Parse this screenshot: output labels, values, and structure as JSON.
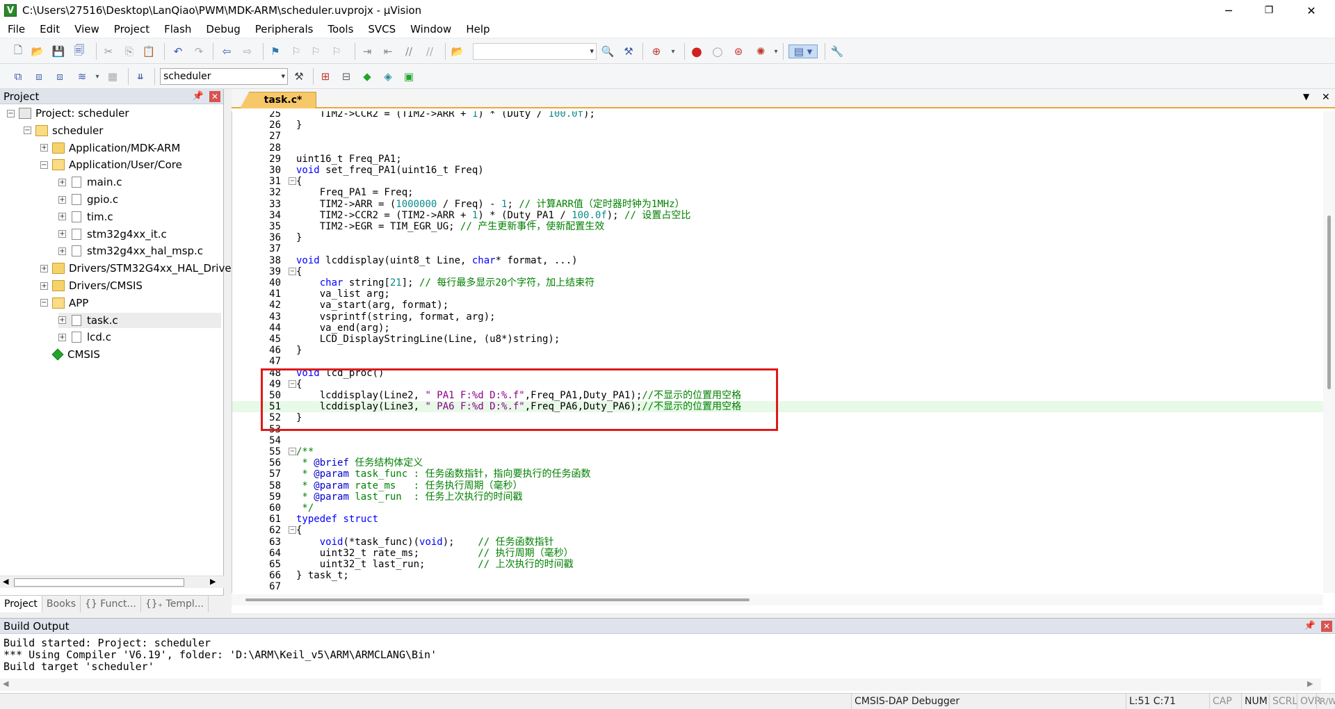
{
  "window": {
    "title": "C:\\Users\\27516\\Desktop\\LanQiao\\PWM\\MDK-ARM\\scheduler.uvprojx - µVision",
    "minimize": "─",
    "restore": "❐",
    "close": "✕"
  },
  "menu": [
    "File",
    "Edit",
    "View",
    "Project",
    "Flash",
    "Debug",
    "Peripherals",
    "Tools",
    "SVCS",
    "Window",
    "Help"
  ],
  "toolbar2": {
    "target_select": "scheduler"
  },
  "project_panel": {
    "title": "Project",
    "tree": [
      {
        "label": "Project: scheduler",
        "icon": "project-icon",
        "level": 0,
        "expand": "⊟"
      },
      {
        "label": "scheduler",
        "icon": "target-icon",
        "level": 1,
        "expand": "⊟"
      },
      {
        "label": "Application/MDK-ARM",
        "icon": "folder-icon",
        "level": 2,
        "expand": "⊞"
      },
      {
        "label": "Application/User/Core",
        "icon": "folder-open-icon",
        "level": 2,
        "expand": "⊟"
      },
      {
        "label": "main.c",
        "icon": "file-icon",
        "level": 3,
        "expand": "⊞"
      },
      {
        "label": "gpio.c",
        "icon": "file-icon",
        "level": 3,
        "expand": "⊞"
      },
      {
        "label": "tim.c",
        "icon": "file-icon",
        "level": 3,
        "expand": "⊞"
      },
      {
        "label": "stm32g4xx_it.c",
        "icon": "file-icon",
        "level": 3,
        "expand": "⊞"
      },
      {
        "label": "stm32g4xx_hal_msp.c",
        "icon": "file-icon",
        "level": 3,
        "expand": "⊞"
      },
      {
        "label": "Drivers/STM32G4xx_HAL_Driver",
        "icon": "folder-icon",
        "level": 2,
        "expand": "⊞"
      },
      {
        "label": "Drivers/CMSIS",
        "icon": "folder-icon",
        "level": 2,
        "expand": "⊞"
      },
      {
        "label": "APP",
        "icon": "folder-open-icon",
        "level": 2,
        "expand": "⊟"
      },
      {
        "label": "task.c",
        "icon": "file-icon",
        "level": 3,
        "expand": "⊞",
        "selected": true
      },
      {
        "label": "lcd.c",
        "icon": "file-icon",
        "level": 3,
        "expand": "⊞"
      },
      {
        "label": "CMSIS",
        "icon": "cmsis-icon",
        "level": 2,
        "expand": ""
      }
    ],
    "tabs": [
      "Project",
      "Books",
      "{} Funct...",
      "{}₊ Templ..."
    ]
  },
  "editor": {
    "tab_label": "task.c*",
    "lines": [
      {
        "n": "25",
        "fold": "",
        "parts": [
          [
            "",
            "    TIM2->CCR2 = (TIM2->ARR + "
          ],
          [
            "num",
            "1"
          ],
          [
            "",
            ") * (Duty / "
          ],
          [
            "num",
            "100.0f"
          ],
          [
            "",
            ");"
          ]
        ]
      },
      {
        "n": "26",
        "fold": "",
        "parts": [
          [
            "",
            "}"
          ]
        ]
      },
      {
        "n": "27",
        "fold": "",
        "parts": []
      },
      {
        "n": "28",
        "fold": "",
        "parts": []
      },
      {
        "n": "29",
        "fold": "",
        "parts": [
          [
            "",
            "uint16_t Freq_PA1;"
          ]
        ]
      },
      {
        "n": "30",
        "fold": "",
        "parts": [
          [
            "kw",
            "void"
          ],
          [
            "",
            " set_freq_PA1(uint16_t Freq)"
          ]
        ]
      },
      {
        "n": "31",
        "fold": "⊟",
        "parts": [
          [
            "",
            "{"
          ]
        ]
      },
      {
        "n": "32",
        "fold": "",
        "parts": [
          [
            "",
            "    Freq_PA1 = Freq;"
          ]
        ]
      },
      {
        "n": "33",
        "fold": "",
        "parts": [
          [
            "",
            "    TIM2->ARR = ("
          ],
          [
            "num",
            "1000000"
          ],
          [
            "",
            " / Freq) - "
          ],
          [
            "num",
            "1"
          ],
          [
            "",
            "; "
          ],
          [
            "cmt",
            "// 计算ARR值（定时器时钟为1MHz）"
          ]
        ]
      },
      {
        "n": "34",
        "fold": "",
        "parts": [
          [
            "",
            "    TIM2->CCR2 = (TIM2->ARR + "
          ],
          [
            "num",
            "1"
          ],
          [
            "",
            ") * (Duty_PA1 / "
          ],
          [
            "num",
            "100.0f"
          ],
          [
            "",
            "); "
          ],
          [
            "cmt",
            "// 设置占空比"
          ]
        ]
      },
      {
        "n": "35",
        "fold": "",
        "parts": [
          [
            "",
            "    TIM2->EGR = TIM_EGR_UG; "
          ],
          [
            "cmt",
            "// 产生更新事件，使新配置生效"
          ]
        ]
      },
      {
        "n": "36",
        "fold": "",
        "parts": [
          [
            "",
            "}"
          ]
        ]
      },
      {
        "n": "37",
        "fold": "",
        "parts": []
      },
      {
        "n": "38",
        "fold": "",
        "parts": [
          [
            "kw",
            "void"
          ],
          [
            "",
            " lcddisplay(uint8_t Line, "
          ],
          [
            "kw",
            "char"
          ],
          [
            "",
            "* format, ...)"
          ]
        ]
      },
      {
        "n": "39",
        "fold": "⊟",
        "parts": [
          [
            "",
            "{"
          ]
        ]
      },
      {
        "n": "40",
        "fold": "",
        "parts": [
          [
            "",
            "    "
          ],
          [
            "kw",
            "char"
          ],
          [
            "",
            " string["
          ],
          [
            "num",
            "21"
          ],
          [
            "",
            "]; "
          ],
          [
            "cmt",
            "// 每行最多显示20个字符，加上结束符"
          ]
        ]
      },
      {
        "n": "41",
        "fold": "",
        "parts": [
          [
            "",
            "    va_list arg;"
          ]
        ]
      },
      {
        "n": "42",
        "fold": "",
        "parts": [
          [
            "",
            "    va_start(arg, format);"
          ]
        ]
      },
      {
        "n": "43",
        "fold": "",
        "parts": [
          [
            "",
            "    vsprintf(string, format, arg);"
          ]
        ]
      },
      {
        "n": "44",
        "fold": "",
        "parts": [
          [
            "",
            "    va_end(arg);"
          ]
        ]
      },
      {
        "n": "45",
        "fold": "",
        "parts": [
          [
            "",
            "    LCD_DisplayStringLine(Line, (u8*)string);"
          ]
        ]
      },
      {
        "n": "46",
        "fold": "",
        "parts": [
          [
            "",
            "}"
          ]
        ]
      },
      {
        "n": "47",
        "fold": "",
        "parts": []
      },
      {
        "n": "48",
        "fold": "",
        "parts": [
          [
            "kw",
            "void"
          ],
          [
            "",
            " lcd_proc()"
          ]
        ]
      },
      {
        "n": "49",
        "fold": "⊟",
        "parts": [
          [
            "",
            "{"
          ]
        ]
      },
      {
        "n": "50",
        "fold": "",
        "parts": [
          [
            "",
            "    lcddisplay(Line2, "
          ],
          [
            "str",
            "\" PA1 F:%d D:%.f\""
          ],
          [
            "",
            ",Freq_PA1,Duty_PA1);"
          ],
          [
            "cmt",
            "//不显示的位置用空格"
          ]
        ]
      },
      {
        "n": "51",
        "fold": "",
        "current": true,
        "parts": [
          [
            "",
            "    lcddisplay(Line3, "
          ],
          [
            "str",
            "\" PA6 F:%d D:%.f\""
          ],
          [
            "",
            ",Freq_PA6,Duty_PA6);"
          ],
          [
            "cmt",
            "//不显示的位置用空格"
          ]
        ]
      },
      {
        "n": "52",
        "fold": "",
        "parts": [
          [
            "",
            "}"
          ]
        ]
      },
      {
        "n": "53",
        "fold": "",
        "parts": []
      },
      {
        "n": "54",
        "fold": "",
        "parts": []
      },
      {
        "n": "55",
        "fold": "⊟",
        "parts": [
          [
            "cmt",
            "/**"
          ]
        ]
      },
      {
        "n": "56",
        "fold": "",
        "parts": [
          [
            "cmt",
            " * "
          ],
          [
            "tagc",
            "@brief"
          ],
          [
            "cmt",
            " 任务结构体定义"
          ]
        ]
      },
      {
        "n": "57",
        "fold": "",
        "parts": [
          [
            "cmt",
            " * "
          ],
          [
            "tagc",
            "@param"
          ],
          [
            "cmt",
            " task_func : 任务函数指针，指向要执行的任务函数"
          ]
        ]
      },
      {
        "n": "58",
        "fold": "",
        "parts": [
          [
            "cmt",
            " * "
          ],
          [
            "tagc",
            "@param"
          ],
          [
            "cmt",
            " rate_ms   : 任务执行周期（毫秒）"
          ]
        ]
      },
      {
        "n": "59",
        "fold": "",
        "parts": [
          [
            "cmt",
            " * "
          ],
          [
            "tagc",
            "@param"
          ],
          [
            "cmt",
            " last_run  : 任务上次执行的时间戳"
          ]
        ]
      },
      {
        "n": "60",
        "fold": "",
        "parts": [
          [
            "cmt",
            " */"
          ]
        ]
      },
      {
        "n": "61",
        "fold": "",
        "parts": [
          [
            "kw",
            "typedef"
          ],
          [
            "",
            " "
          ],
          [
            "kw",
            "struct"
          ]
        ]
      },
      {
        "n": "62",
        "fold": "⊟",
        "parts": [
          [
            "",
            "{"
          ]
        ]
      },
      {
        "n": "63",
        "fold": "",
        "parts": [
          [
            "",
            "    "
          ],
          [
            "kw",
            "void"
          ],
          [
            "",
            "(*task_func)("
          ],
          [
            "kw",
            "void"
          ],
          [
            "",
            ");    "
          ],
          [
            "cmt",
            "// 任务函数指针"
          ]
        ]
      },
      {
        "n": "64",
        "fold": "",
        "parts": [
          [
            "",
            "    uint32_t rate_ms;          "
          ],
          [
            "cmt",
            "// 执行周期（毫秒）"
          ]
        ]
      },
      {
        "n": "65",
        "fold": "",
        "parts": [
          [
            "",
            "    uint32_t last_run;         "
          ],
          [
            "cmt",
            "// 上次执行的时间戳"
          ]
        ]
      },
      {
        "n": "66",
        "fold": "",
        "parts": [
          [
            "",
            "} task_t;"
          ]
        ]
      },
      {
        "n": "67",
        "fold": "",
        "parts": []
      }
    ]
  },
  "build_output": {
    "title": "Build Output",
    "lines": [
      "Build started: Project: scheduler",
      "*** Using Compiler 'V6.19', folder: 'D:\\ARM\\Keil_v5\\ARM\\ARMCLANG\\Bin'",
      "Build target 'scheduler'"
    ]
  },
  "statusbar": {
    "debugger": "CMSIS-DAP Debugger",
    "position": "L:51 C:71",
    "cap": "CAP",
    "num": "NUM",
    "scrl": "SCRL",
    "ovr": "OVR",
    "rw": "R/W"
  }
}
